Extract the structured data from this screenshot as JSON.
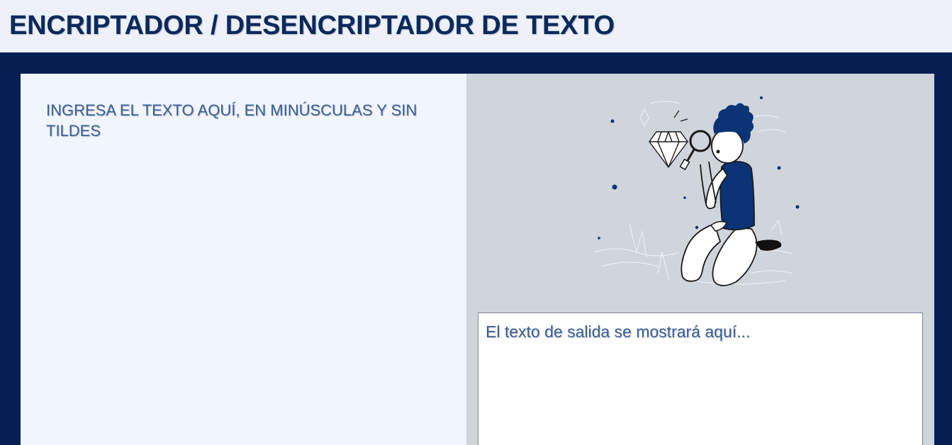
{
  "header": {
    "title": "ENCRIPTADOR / DESENCRIPTADOR DE TEXTO"
  },
  "input": {
    "placeholder": "INGRESA EL TEXTO AQUÍ, EN MINÚSCULAS Y SIN TILDES",
    "value": ""
  },
  "output": {
    "placeholder": "El texto de salida se mostrará aquí..."
  },
  "illustration": {
    "icon": "person-with-magnifying-glass-and-diamond",
    "colors": {
      "accent": "#0a3475",
      "line": "#1a1a1a",
      "faint": "#eef0f4"
    }
  },
  "colors": {
    "header_bg": "#eef1f9",
    "title": "#0a2a5e",
    "frame": "#051f53",
    "left_panel": "#f1f5fd",
    "right_panel": "#d0d4db",
    "text": "#3a5f9a"
  }
}
